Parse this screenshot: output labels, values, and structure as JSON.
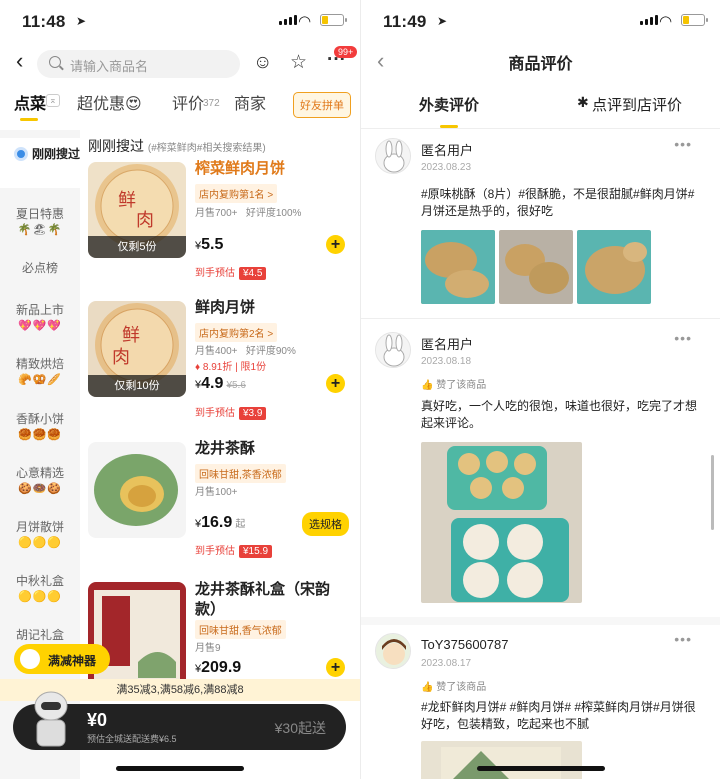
{
  "left": {
    "status": {
      "time": "11:48"
    },
    "search": {
      "placeholder": "请输入商品名"
    },
    "cart_badge": "99+",
    "tabs": [
      {
        "label": "点菜"
      },
      {
        "label": "超优惠😍"
      },
      {
        "label": "评价",
        "count": "372"
      },
      {
        "label": "商家"
      }
    ],
    "friend_btn": "好友拼单",
    "sidebar": [
      {
        "label": "刚刚搜过"
      },
      {
        "label": "夏日特惠",
        "emoji": "🌴🏖🌴"
      },
      {
        "label": "必点榜"
      },
      {
        "label": "新品上市",
        "emoji": "💖💖💖"
      },
      {
        "label": "精致烘焙",
        "emoji": "🥐🥨🥖"
      },
      {
        "label": "香酥小饼",
        "emoji": "🥮🥮🥮"
      },
      {
        "label": "心意精选",
        "emoji": "🍪🍩🍪"
      },
      {
        "label": "月饼散饼",
        "emoji": "🟡🟡🟡"
      },
      {
        "label": "中秋礼盒",
        "emoji": "🟡🟡🟡"
      },
      {
        "label": "胡记礼盒"
      }
    ],
    "section_title": "刚刚搜过",
    "section_sub": "(#榨菜鲜肉#相关搜索结果)",
    "products": [
      {
        "name": "榨菜鲜肉月饼",
        "tag": "店内复购第1名 >",
        "sales": "月售700+",
        "rating": "好评度100%",
        "price": "5.5",
        "stock": "仅剩5份",
        "est": "到手预估",
        "est_price": "¥4.5"
      },
      {
        "name": "鲜肉月饼",
        "tag": "店内复购第2名 >",
        "sales": "月售400+",
        "rating": "好评度90%",
        "discount": "8.91折",
        "limit": "限1份",
        "price": "4.9",
        "orig": "¥5.6",
        "stock": "仅剩10份",
        "est": "到手预估",
        "est_price": "¥3.9"
      },
      {
        "name": "龙井茶酥",
        "tag": "回味甘甜,茶香浓郁",
        "sales": "月售100+",
        "price": "16.9",
        "suffix": "起",
        "spec": "选规格",
        "est": "到手预估",
        "est_price": "¥15.9"
      },
      {
        "name": "龙井茶酥礼盒（宋韵款）",
        "tag": "回味甘甜,香气浓郁",
        "sales": "月售9",
        "price": "209.9"
      }
    ],
    "promo": "满35减3,满58减6,满88减8",
    "tool": "满减神器",
    "cart": {
      "amount": "¥0",
      "fee": "预估全城送配送费¥6.5",
      "start": "¥30起送"
    }
  },
  "right": {
    "status": {
      "time": "11:49"
    },
    "title": "商品评价",
    "tabs": [
      {
        "label": "外卖评价"
      },
      {
        "label": "点评到店评价"
      }
    ],
    "reviews": [
      {
        "user": "匿名用户",
        "date": "2023.08.23",
        "text": "#原味桃酥（8片）#很酥脆，不是很甜腻#鲜肉月饼#月饼还是热乎的，很好吃"
      },
      {
        "user": "匿名用户",
        "date": "2023.08.18",
        "liked": "赞了该商品",
        "text": "真好吃，一个人吃的很饱，味道也很好，吃完了才想起来评论。"
      },
      {
        "user": "ToY375600787",
        "date": "2023.08.17",
        "liked": "赞了该商品",
        "text": "#龙虾鲜肉月饼# #鲜肉月饼# #榨菜鲜肉月饼#月饼很好吃，包装精致，吃起来也不腻"
      }
    ]
  },
  "colors": {
    "accent": "#ffd200",
    "price_red": "#e8413a",
    "highlight": "#f7c600"
  }
}
